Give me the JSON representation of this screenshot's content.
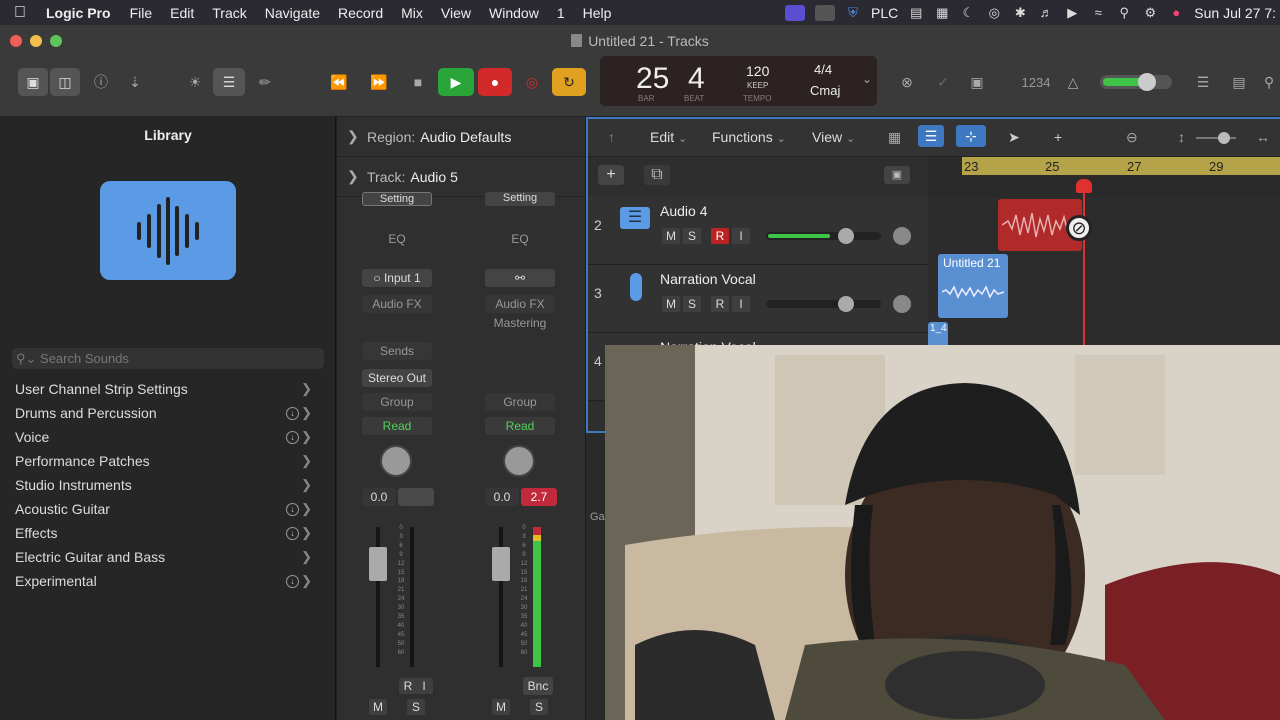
{
  "menubar": {
    "app": "Logic Pro",
    "items": [
      "File",
      "Edit",
      "Track",
      "Navigate",
      "Record",
      "Mix",
      "View",
      "Window",
      "1",
      "Help"
    ],
    "plc": "PLC",
    "clock": "Sun Jul 27  7:"
  },
  "window": {
    "title": "Untitled 21 - Tracks"
  },
  "transport": {
    "bar": "25",
    "beat": "4",
    "bar_label": "BAR",
    "beat_label": "BEAT",
    "tempo": "120",
    "tempo_mode": "KEEP",
    "tempo_label": "TEMPO",
    "signature": "4/4",
    "key": "Cmaj",
    "count_in": "1234",
    "colors": {
      "play": "#2aa53a",
      "record": "#d22a2a",
      "cycle": "#e0a020"
    }
  },
  "library": {
    "title": "Library",
    "search_placeholder": "Search Sounds",
    "items": [
      {
        "label": "User Channel Strip Settings",
        "download": false
      },
      {
        "label": "Drums and Percussion",
        "download": true
      },
      {
        "label": "Voice",
        "download": true
      },
      {
        "label": "Performance Patches",
        "download": false
      },
      {
        "label": "Studio Instruments",
        "download": false
      },
      {
        "label": "Acoustic Guitar",
        "download": true
      },
      {
        "label": "Effects",
        "download": true
      },
      {
        "label": "Electric Guitar and Bass",
        "download": false
      },
      {
        "label": "Experimental",
        "download": true
      }
    ]
  },
  "inspector": {
    "region_label": "Region:",
    "region_value": "Audio Defaults",
    "track_label": "Track:",
    "track_value": "Audio 5",
    "strip1": {
      "setting": "Setting",
      "eq": "EQ",
      "input": "Input 1",
      "audio_fx": "Audio FX",
      "sends": "Sends",
      "output": "Stereo Out",
      "group": "Group",
      "automation": "Read",
      "vol": "0.0",
      "r": "R",
      "i": "I",
      "m": "M",
      "s": "S"
    },
    "strip2": {
      "setting": "Setting",
      "eq": "EQ",
      "audio_fx": "Audio FX",
      "mastering": "Mastering",
      "group": "Group",
      "automation": "Read",
      "vol": "0.0",
      "peak": "2.7",
      "bnc": "Bnc",
      "m": "M",
      "s": "S"
    },
    "scale": [
      "0",
      "3",
      "6",
      "9",
      "12",
      "15",
      "18",
      "21",
      "24",
      "30",
      "35",
      "40",
      "45",
      "50",
      "60"
    ]
  },
  "tracks_area": {
    "menus": {
      "edit": "Edit",
      "functions": "Functions",
      "view": "View"
    },
    "ruler": [
      "23",
      "25",
      "27",
      "29"
    ],
    "tracks": [
      {
        "num": "2",
        "name": "Audio 4",
        "m": "M",
        "s": "S",
        "r": "R",
        "i": "I",
        "volume": 0.72
      },
      {
        "num": "3",
        "name": "Narration Vocal",
        "m": "M",
        "s": "S",
        "r": "R",
        "i": "I",
        "volume": 0
      },
      {
        "num": "4",
        "name": "Narration Vocal"
      }
    ],
    "regions": [
      {
        "label": "Untitled 21",
        "color": "#5a8fd1"
      },
      {
        "label": "1_4",
        "color": "#5a8fd1"
      }
    ],
    "red_region_color": "#b02a2a",
    "partial_label": "Ga"
  }
}
